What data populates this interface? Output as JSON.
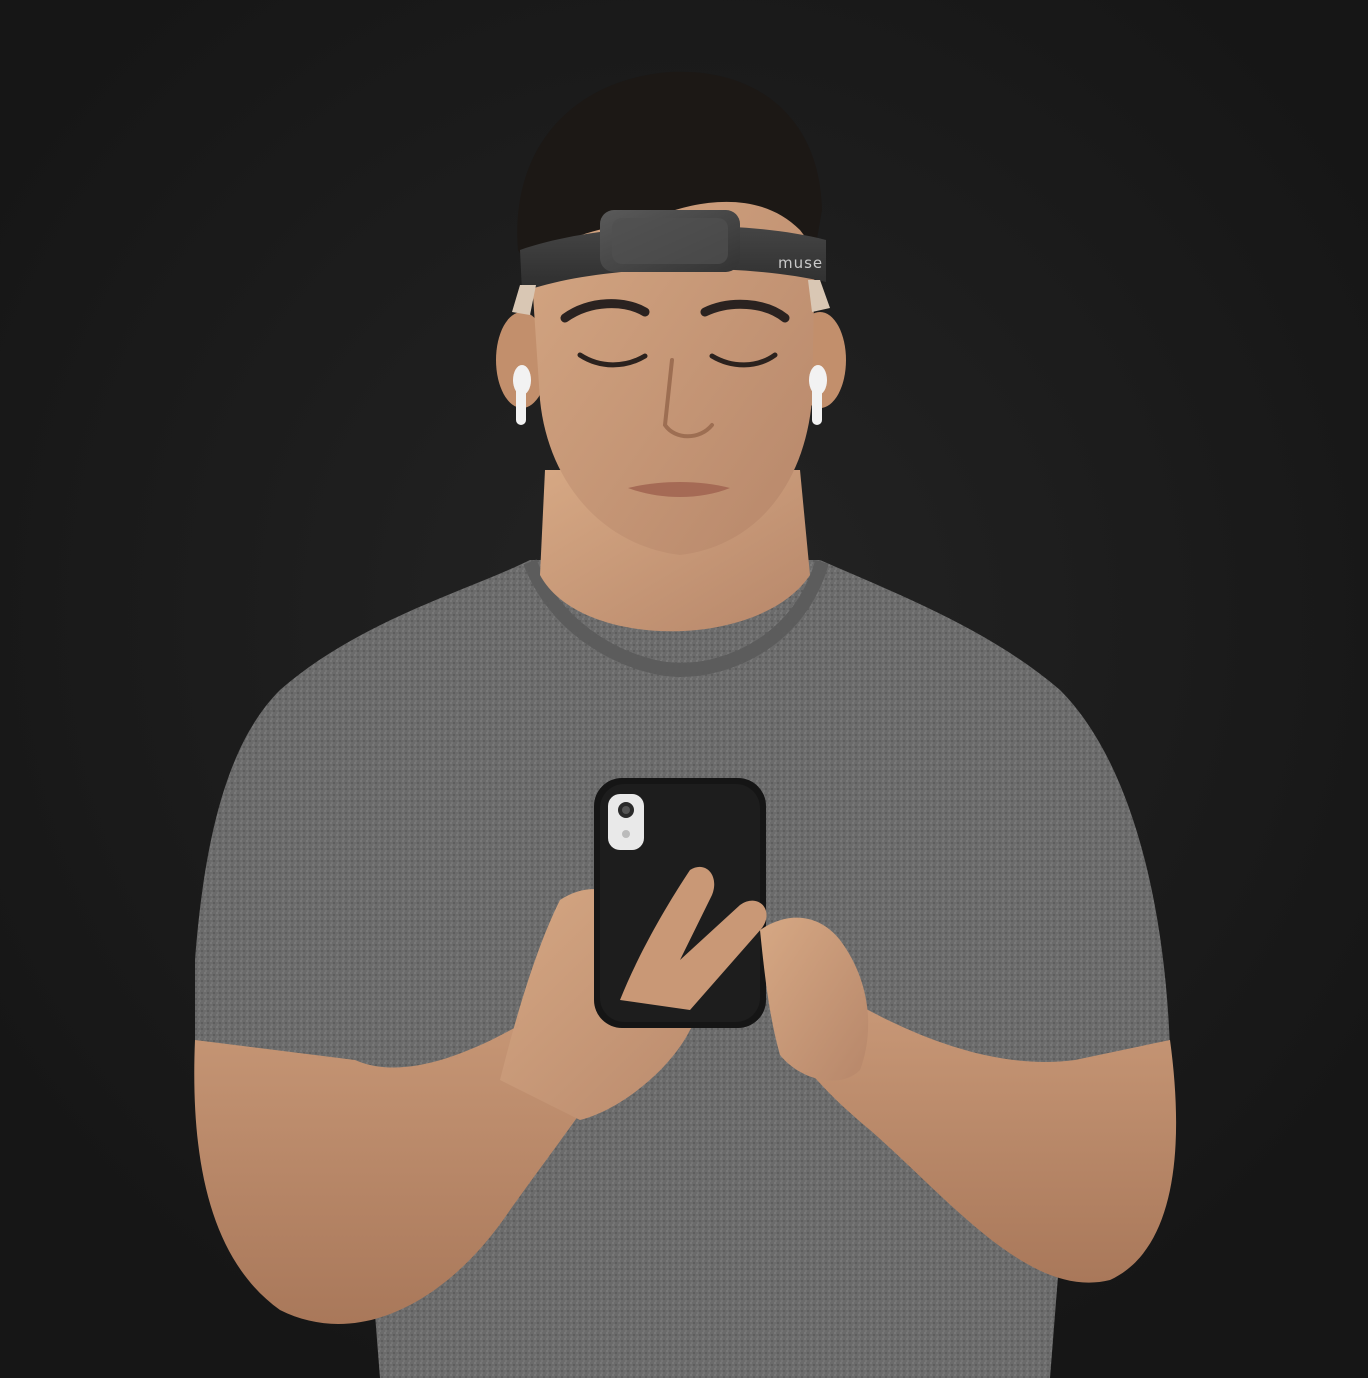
{
  "scene": {
    "background_color": "#1b1b1b",
    "subject": "person-wearing-headband-using-phone",
    "headband": {
      "brand_text": "muse"
    },
    "colors": {
      "skin": "#c79a78",
      "shirt": "#6e6e6e",
      "hair": "#1c1815",
      "headband_fabric": "#3a3a3a",
      "headband_module": "#4a4a4a",
      "phone_case": "#151515",
      "earbud": "#f2f2f2"
    }
  }
}
